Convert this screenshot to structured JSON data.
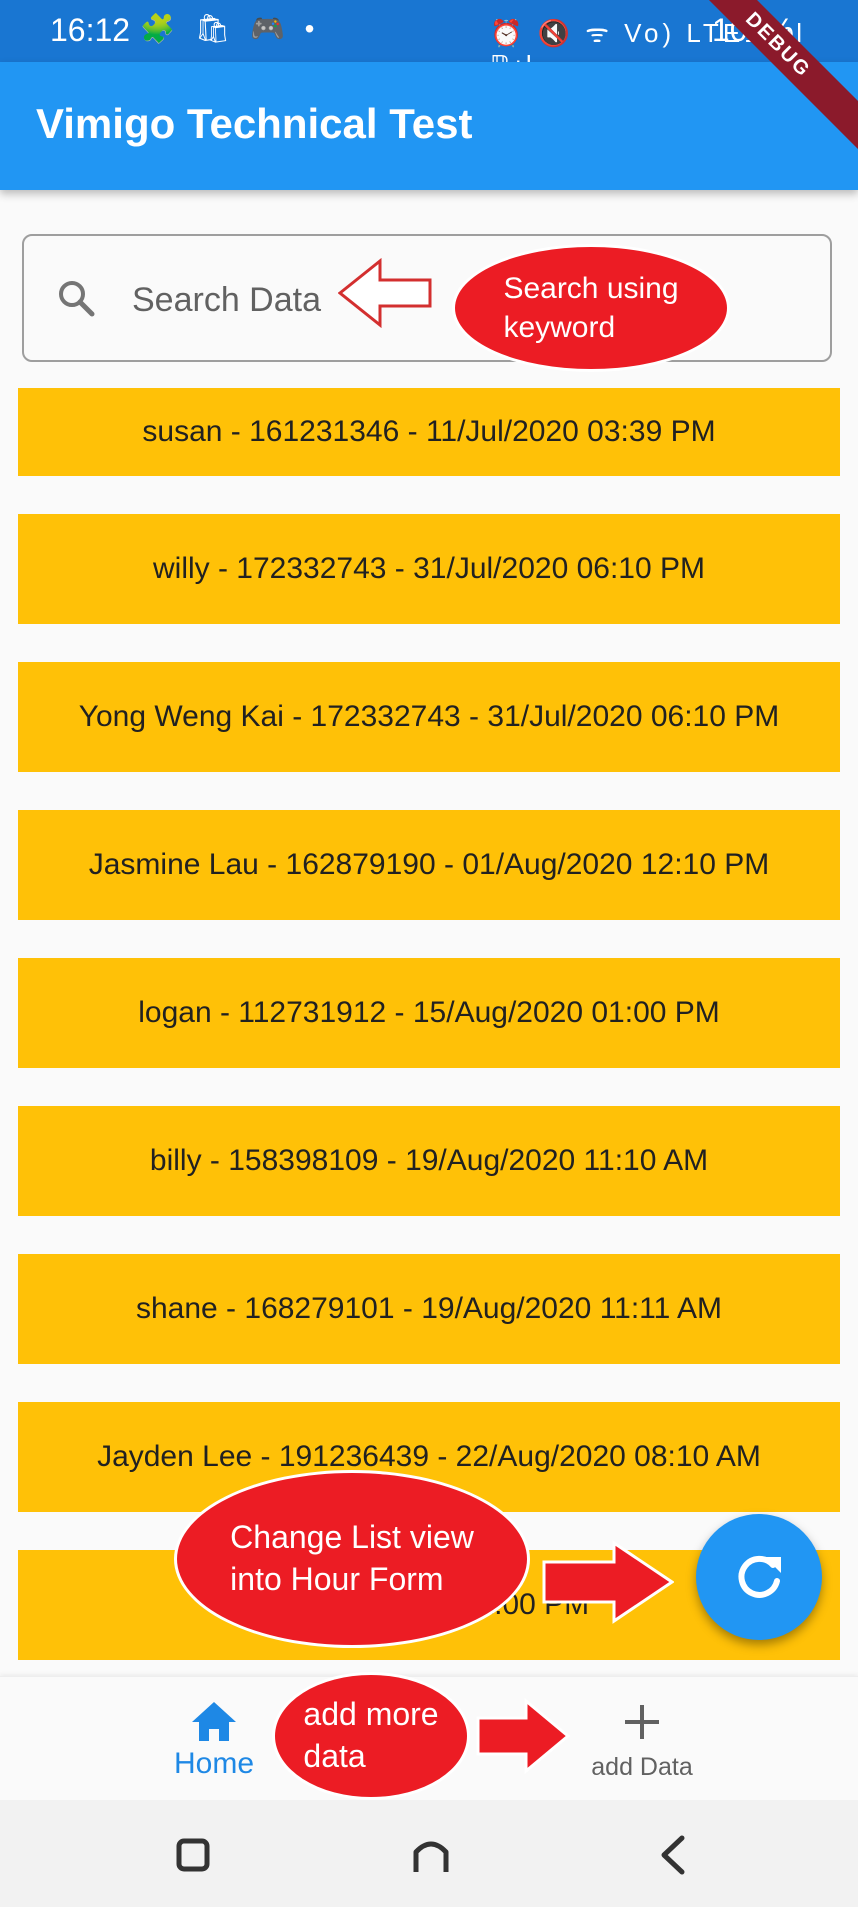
{
  "status_bar": {
    "time": "16:12",
    "left_icons": "🧩 🛍 🎮 •",
    "right_icons": "⏰ 🔇 ᯤ Vo) LTE1 .ıl ℝıl",
    "battery": "100%",
    "debug_label": "DEBUG"
  },
  "app_bar": {
    "title": "Vimigo Technical Test"
  },
  "search": {
    "placeholder": "Search Data",
    "icon": "search-icon"
  },
  "list": {
    "items": [
      {
        "text": "susan - 161231346 - 11/Jul/2020 03:39 PM"
      },
      {
        "text": "willy - 172332743 - 31/Jul/2020 06:10 PM"
      },
      {
        "text": "Yong Weng Kai - 172332743 - 31/Jul/2020 06:10 PM"
      },
      {
        "text": "Jasmine Lau - 162879190 - 01/Aug/2020 12:10 PM"
      },
      {
        "text": "logan - 112731912 - 15/Aug/2020 01:00 PM"
      },
      {
        "text": "billy - 158398109 - 19/Aug/2020 11:10 AM"
      },
      {
        "text": "shane - 168279101 - 19/Aug/2020 11:11 AM"
      },
      {
        "text": "Jayden Lee - 191236439 - 22/Aug/2020 08:10 AM"
      },
      {
        "text": "bobby - 1/2020 1:00 PM"
      }
    ]
  },
  "fab": {
    "icon": "refresh-icon"
  },
  "bottom_nav": {
    "home_label": "Home",
    "add_label": "add Data",
    "home_icon": "home-icon",
    "add_icon": "plus-icon"
  },
  "annotations": {
    "search": "Search using\nkeyword",
    "list_view": "Change List view\ninto Hour Form",
    "add_data": "add more\ndata"
  },
  "colors": {
    "app_bar": "#2196f3",
    "status_bar": "#1976d2",
    "list_item": "#ffc107",
    "annotation": "#ec1c24",
    "active_nav": "#1e88e5"
  }
}
